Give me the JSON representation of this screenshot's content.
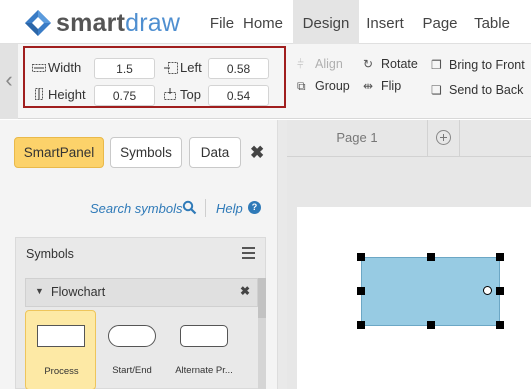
{
  "app": {
    "logo_text_a": "smart",
    "logo_text_b": "draw",
    "logo_icon": "smartdraw-diamond-logo"
  },
  "menu": {
    "items": [
      "File",
      "Home",
      "Design",
      "Insert",
      "Page",
      "Table"
    ],
    "active": "Design"
  },
  "ribbon": {
    "width_label": "Width",
    "width_value": "1.5",
    "height_label": "Height",
    "height_value": "0.75",
    "left_label": "Left",
    "left_value": "0.58",
    "top_label": "Top",
    "top_value": "0.54",
    "align_label": "Align",
    "group_label": "Group",
    "rotate_label": "Rotate",
    "flip_label": "Flip",
    "bring_front_label": "Bring to Front",
    "send_back_label": "Send to Back",
    "highlight_color": "#a01e1e"
  },
  "panel": {
    "tabs": [
      "SmartPanel",
      "Symbols",
      "Data"
    ],
    "active_tab": "SmartPanel",
    "search_label": "Search symbols",
    "help_label": "Help",
    "symbols_title": "Symbols",
    "library_title": "Flowchart",
    "symbols": [
      {
        "label": "Process",
        "selected": true
      },
      {
        "label": "Start/End",
        "selected": false
      },
      {
        "label": "Alternate Pr...",
        "selected": false
      }
    ]
  },
  "canvas": {
    "page_tab": "Page 1",
    "shape_fill": "#97cbe3"
  }
}
